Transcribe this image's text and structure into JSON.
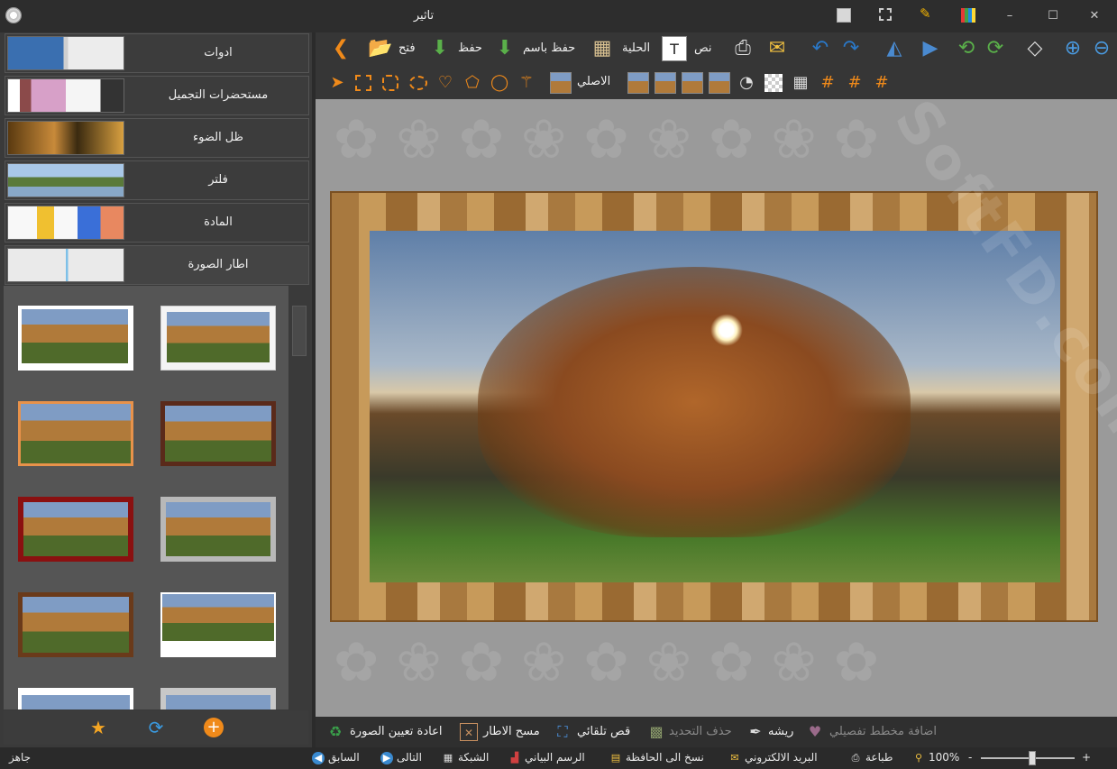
{
  "window": {
    "title": "تاثير"
  },
  "sidebar": {
    "categories": [
      {
        "label": "ادوات"
      },
      {
        "label": "مستحضرات التجميل"
      },
      {
        "label": "ظل الضوء"
      },
      {
        "label": "فلتر"
      },
      {
        "label": "المادة"
      },
      {
        "label": "اطار الصورة"
      }
    ]
  },
  "toolbar": {
    "open_label": "فتح",
    "save_label": "حفظ",
    "save_as_label": "حفظ باسم",
    "ornament_label": "الحلية",
    "text_label": "نص",
    "original_label": "الاصلي"
  },
  "actions": {
    "add_detail_outline": "اضافة مخطط تفصيلي",
    "feather": "ريشه",
    "delete_selection": "حذف التحديد",
    "auto_crop": "قص تلقائي",
    "erase_frame": "مسح الاطار",
    "reset_image": "اعادة تعيين الصورة"
  },
  "status": {
    "ready": "جاهز",
    "previous": "السابق",
    "next": "التالى",
    "grid": "الشبكة",
    "chart": "الرسم البياني",
    "copy_clipboard": "نسخ الى الحافظة",
    "email": "البريد الالكتروني",
    "print": "طباعة",
    "zoom": "100%",
    "zoom_minus": "-",
    "zoom_plus": "+"
  },
  "watermark": "SoftFD.com",
  "colors": {
    "accent": "#f08a1a",
    "blue": "#3a9ae0",
    "background": "#2b2b2b"
  }
}
